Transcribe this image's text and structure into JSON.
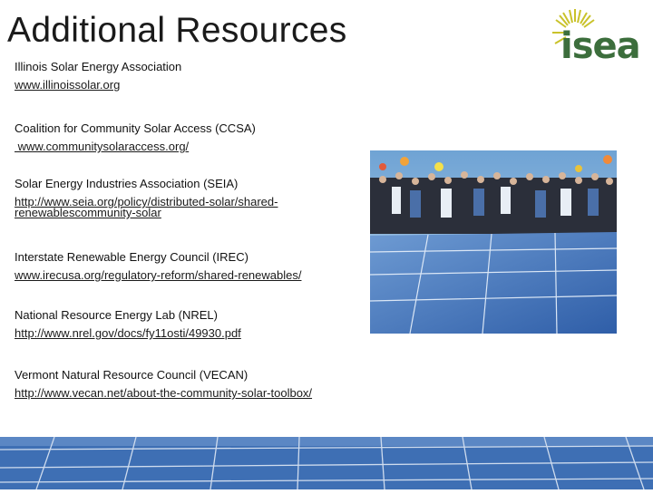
{
  "slide": {
    "title": "Additional Resources",
    "logo_text": "isea"
  },
  "resources": [
    {
      "name": "Illinois Solar Energy Association",
      "link": "www.illinoissolar.org"
    },
    {
      "name": "Coalition for Community Solar Access (CCSA)",
      "link": " www.communitysolaraccess.org/"
    },
    {
      "name": "Solar Energy Industries Association (SEIA)",
      "link": "http://www.seia.org/policy/distributed-solar/shared-",
      "link2": "renewablescommunity-solar"
    },
    {
      "name": "Interstate Renewable Energy Council (IREC)",
      "link": "www.irecusa.org/regulatory-reform/shared-renewables/"
    },
    {
      "name": "National Resource Energy Lab (NREL)",
      "link": "http://www.nrel.gov/docs/fy11osti/49930.pdf"
    },
    {
      "name": "Vermont Natural Resource Council (VECAN)",
      "link": "http://www.vecan.net/about-the-community-solar-toolbox/"
    }
  ],
  "colors": {
    "logo_green": "#3c6e3c",
    "sun_yellow": "#c9c22a",
    "panel_blue": "#3f73b8",
    "sky_blue": "#8fb6d9"
  },
  "icons": {
    "logo": "isea-sun-logo",
    "photo": "solar-team-photo",
    "banner": "solar-panel-banner"
  }
}
